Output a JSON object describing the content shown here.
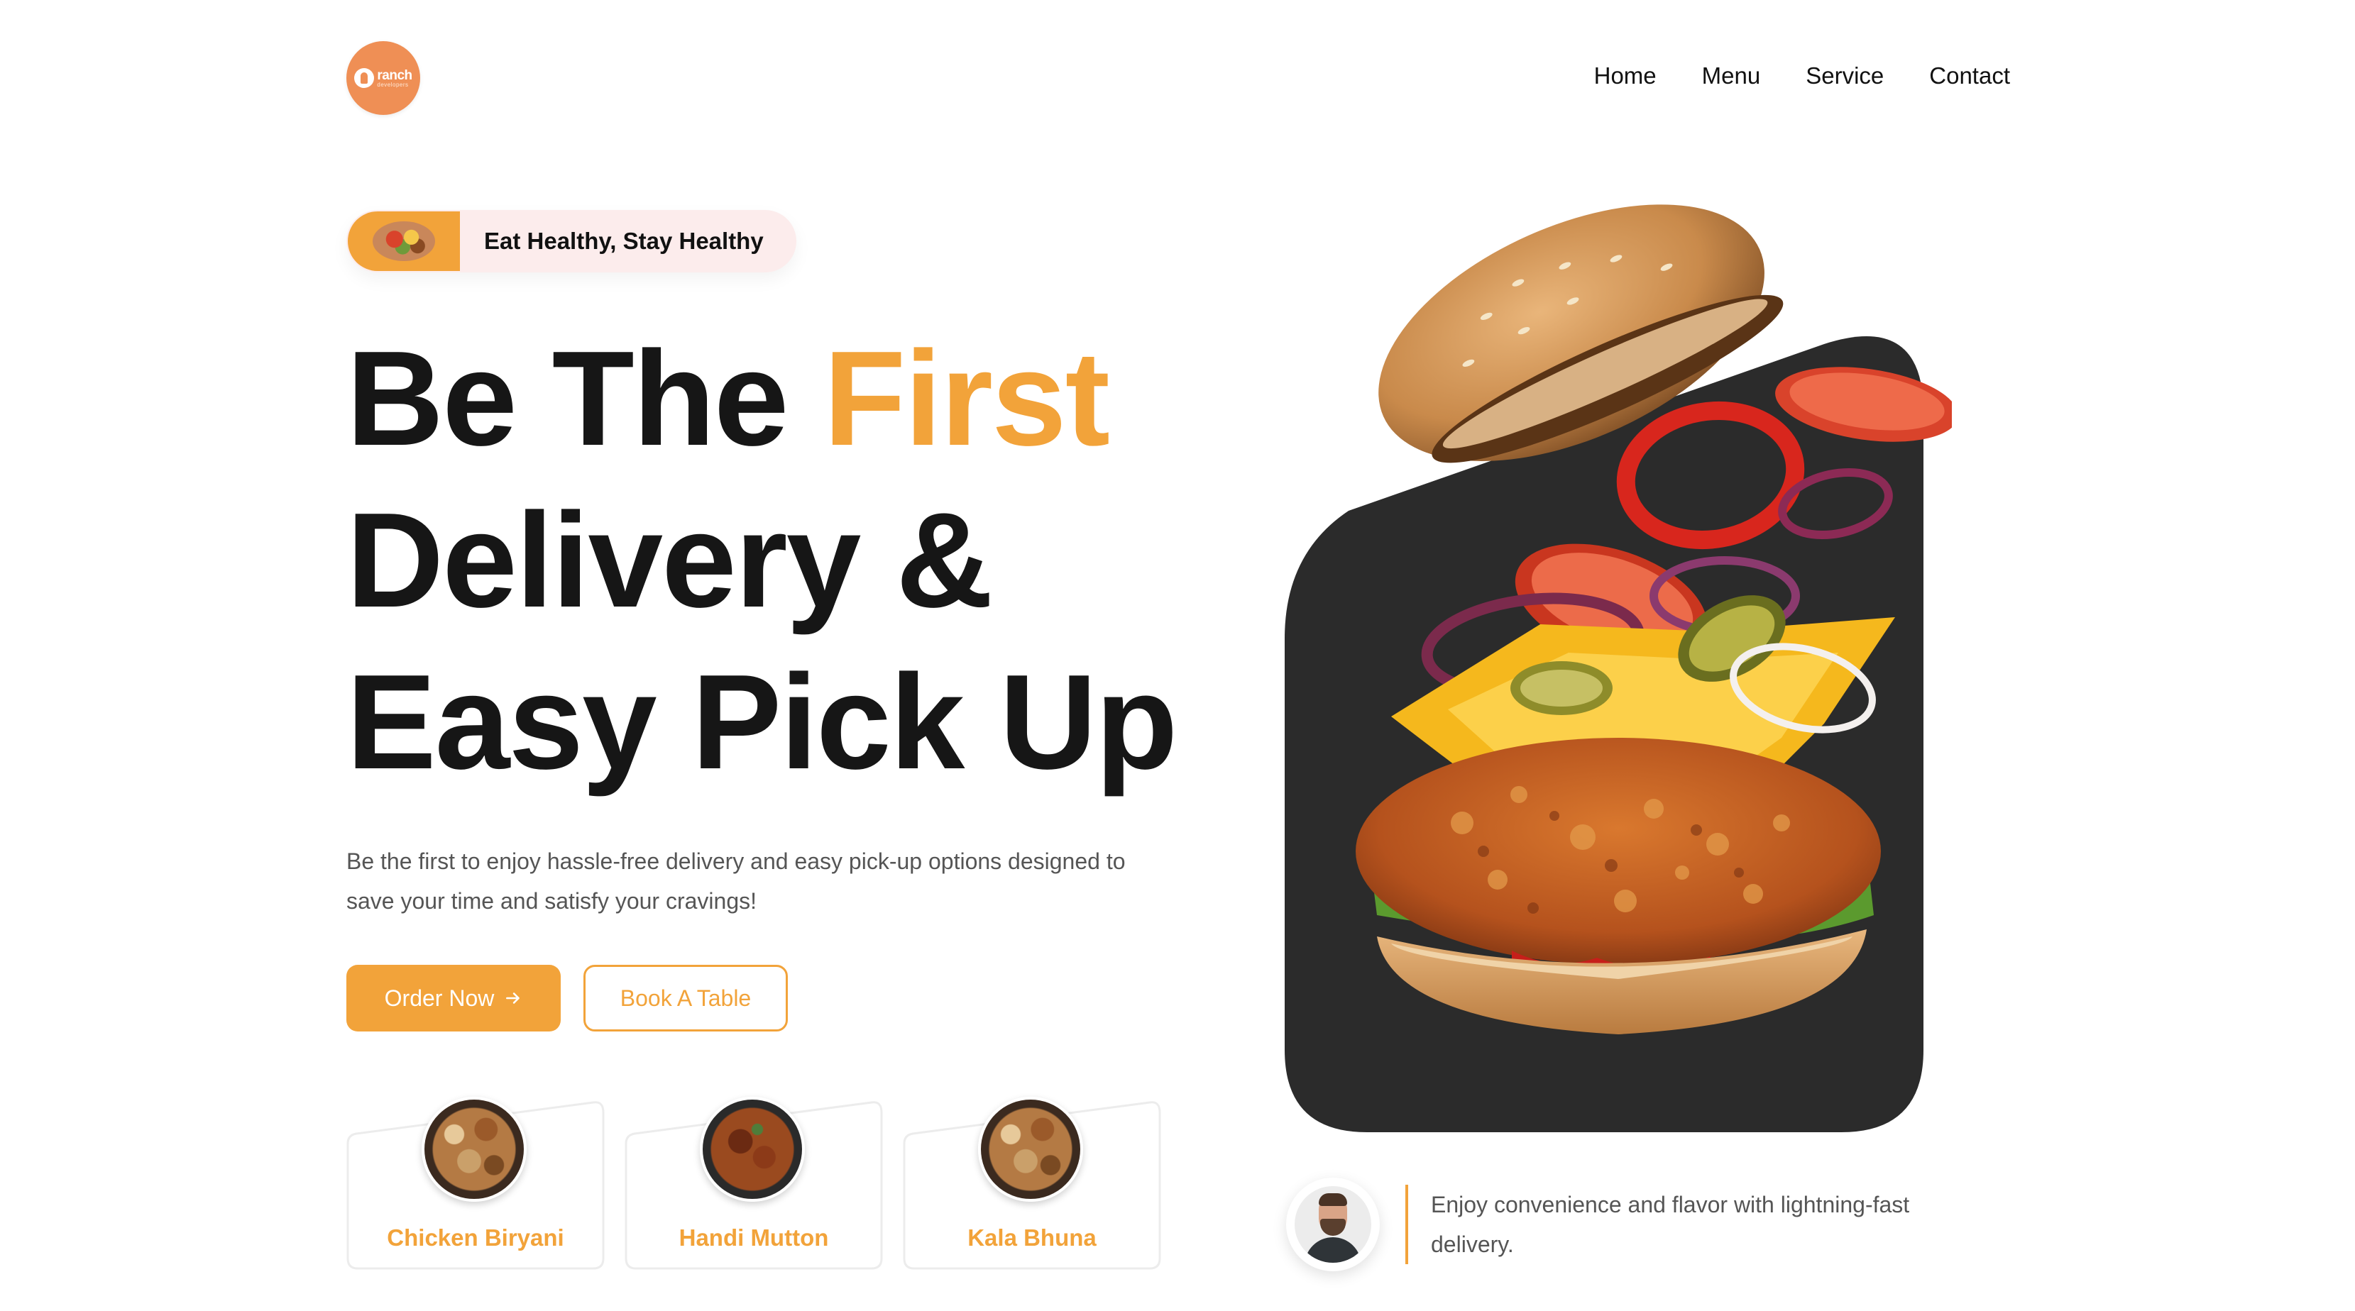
{
  "header": {
    "logo": {
      "word": "ranch",
      "sub": "developers"
    },
    "nav": [
      "Home",
      "Menu",
      "Service",
      "Contact"
    ]
  },
  "hero": {
    "tagline": "Eat Healthy, Stay Healthy",
    "headline": {
      "line1_prefix": "Be The ",
      "line1_accent": "First",
      "line2": "Delivery &",
      "line3": "Easy Pick Up"
    },
    "description": "Be the first to enjoy hassle-free delivery and easy pick-up options designed to save your time and satisfy your cravings!",
    "primary_button": "Order Now",
    "primary_button_icon": "arrow-right-icon",
    "secondary_button": "Book A Table"
  },
  "dishes": [
    {
      "name": "Chicken Biryani",
      "image": "biryani"
    },
    {
      "name": "Handi Mutton",
      "image": "mutton"
    },
    {
      "name": "Kala Bhuna",
      "image": "biryani"
    }
  ],
  "feature": {
    "text": "Enjoy convenience and flavor with lightning-fast delivery."
  },
  "colors": {
    "accent": "#f2a33a",
    "logo": "#ef8f55",
    "dark_panel": "#2b2b2b",
    "tag_bg": "#fcecec"
  }
}
